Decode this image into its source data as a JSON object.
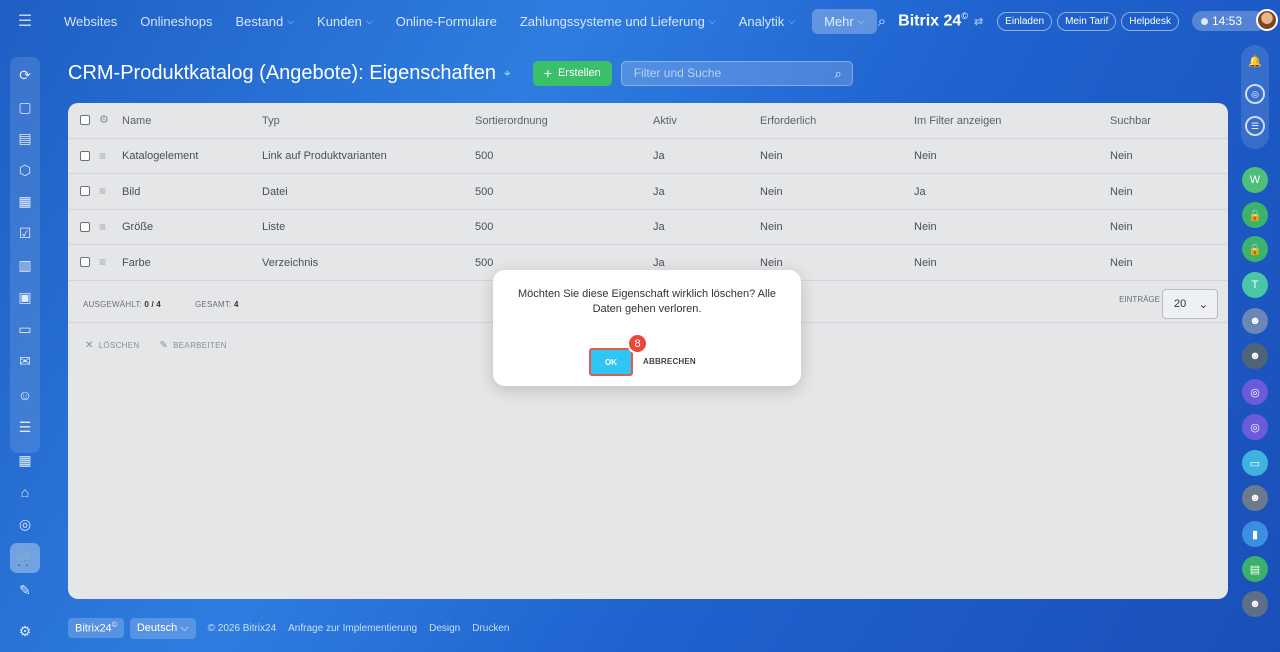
{
  "topbar": {
    "nav": [
      {
        "label": "Websites",
        "dropdown": false
      },
      {
        "label": "Onlineshops",
        "dropdown": false
      },
      {
        "label": "Bestand",
        "dropdown": true
      },
      {
        "label": "Kunden",
        "dropdown": true
      },
      {
        "label": "Online-Formulare",
        "dropdown": false
      },
      {
        "label": "Zahlungssysteme und Lieferung",
        "dropdown": true
      },
      {
        "label": "Analytik",
        "dropdown": true
      },
      {
        "label": "Mehr",
        "dropdown": true
      }
    ],
    "brand": "Bitrix 24",
    "invite": "Einladen",
    "tariff": "Mein Tarif",
    "helpdesk": "Helpdesk",
    "time": "14:53"
  },
  "page": {
    "title": "CRM-Produktkatalog (Angebote): Eigenschaften",
    "create_label": "Erstellen",
    "filter_placeholder": "Filter und Suche"
  },
  "table": {
    "columns": [
      "Name",
      "Typ",
      "Sortierordnung",
      "Aktiv",
      "Erforderlich",
      "Im Filter anzeigen",
      "Suchbar"
    ],
    "rows": [
      [
        "Katalogelement",
        "Link auf Produktvarianten",
        "500",
        "Ja",
        "Nein",
        "Nein",
        "Nein"
      ],
      [
        "Bild",
        "Datei",
        "500",
        "Ja",
        "Nein",
        "Ja",
        "Nein"
      ],
      [
        "Größe",
        "Liste",
        "500",
        "Ja",
        "Nein",
        "Nein",
        "Nein"
      ],
      [
        "Farbe",
        "Verzeichnis",
        "500",
        "Ja",
        "Nein",
        "Nein",
        "Nein"
      ]
    ],
    "selected_label": "Ausgewählt:",
    "selected_value": "0 / 4",
    "total_label": "Gesamt:",
    "total_value": "4",
    "entries_label": "Einträge",
    "entries_value": "20",
    "delete_label": "Löschen",
    "edit_label": "Bearbeiten"
  },
  "dialog": {
    "message": "Möchten Sie diese Eigenschaft wirklich löschen? Alle Daten gehen verloren.",
    "ok_label": "OK",
    "cancel_label": "Abbrechen",
    "step_number": "8"
  },
  "footer": {
    "brand": "Bitrix24",
    "language": "Deutsch",
    "copyright": "© 2026 Bitrix24",
    "links": [
      "Anfrage zur Implementierung",
      "Design",
      "Drucken"
    ]
  },
  "colors": {
    "accent_green": "#3bc06a",
    "ok_blue": "#2fc6f6",
    "highlight_red": "#e05b4b"
  }
}
